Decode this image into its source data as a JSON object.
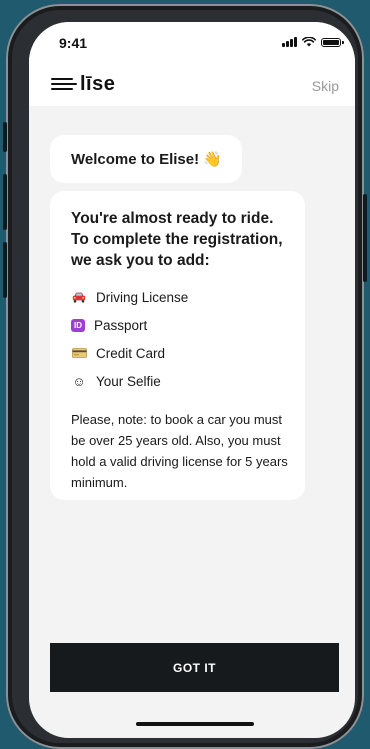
{
  "status_bar": {
    "time": "9:41"
  },
  "header": {
    "logo_text": "līse",
    "skip_label": "Skip"
  },
  "chat": {
    "welcome": "Welcome to Elise! 👋",
    "intro": "You're almost ready to ride.\nTo complete the registration,\nwe  ask you to add:",
    "items": [
      {
        "icon": "car-icon",
        "glyph": "🚘",
        "label": "Driving License"
      },
      {
        "icon": "id-icon",
        "glyph": "ID",
        "label": "Passport"
      },
      {
        "icon": "credit-card-icon",
        "glyph": "",
        "label": "Credit Card"
      },
      {
        "icon": "smiley-icon",
        "glyph": "☺",
        "label": "Your Selfie"
      }
    ],
    "note": "Please, note: to book a car you must be over 25 years old. Also, you must hold a valid driving license for 5 years minimum."
  },
  "cta": {
    "label": "GOT IT"
  },
  "colors": {
    "background": "#1f5a6e",
    "screen": "#f3f3f3",
    "button": "#171a1c",
    "id_badge": "#9b3fd6"
  }
}
